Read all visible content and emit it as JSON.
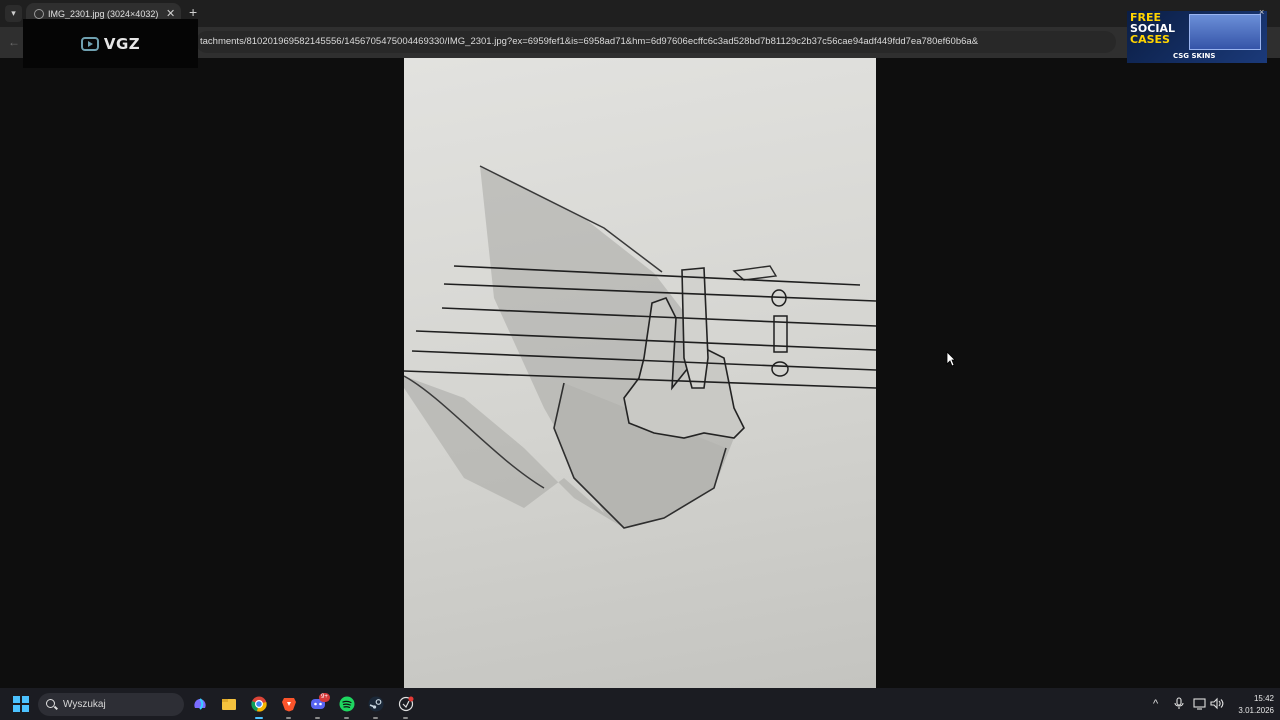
{
  "browser": {
    "tab_title": "IMG_2301.jpg (3024×4032)",
    "url": "tachments/810201969582145556/1456705475004469330/IMG_2301.jpg?ex=6959fef1&is=6958ad71&hm=6d97606ecffc6c3ad528bd7b81129c2b37c56cae94adf449fdd7ea780ef60b6a&"
  },
  "overlay": {
    "logo_text": "VGZ"
  },
  "ad": {
    "line1": "FREE",
    "line2": "SOCIAL",
    "line3": "CASES",
    "brand": "CSG SKINS"
  },
  "taskbar": {
    "search_text": "Wyszukaj",
    "discord_badge": "9+",
    "time": "15:42",
    "date": "3.01.2026"
  },
  "colors": {
    "accent": "#4cc2ff",
    "ad_yellow": "#ffd400"
  }
}
